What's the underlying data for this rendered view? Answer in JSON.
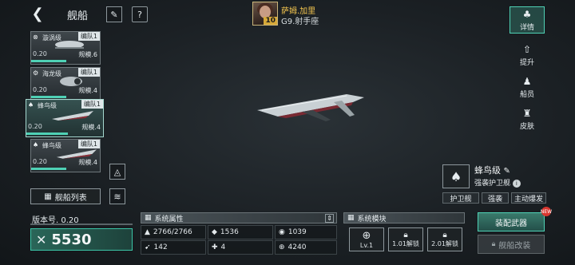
{
  "header": {
    "title": "舰船"
  },
  "captain": {
    "name": "萨姆.加里",
    "subtitle": "G9.射手座",
    "level": "10"
  },
  "ship_list": [
    {
      "name": "漩涡级",
      "fleet": "编队1",
      "level": "0.20",
      "scale": "规模.6",
      "selected": false
    },
    {
      "name": "海龙级",
      "fleet": "编队1",
      "level": "0.20",
      "scale": "规模.4",
      "selected": false
    },
    {
      "name": "蜂鸟级",
      "fleet": "编队1",
      "level": "0.20",
      "scale": "规模.4",
      "selected": true
    },
    {
      "name": "蜂鸟级",
      "fleet": "编队1",
      "level": "0.20",
      "scale": "规模.4",
      "selected": false
    }
  ],
  "fleet_list_label": "舰船列表",
  "version_label": "版本号. 0.20",
  "power": "5530",
  "attributes": {
    "title": "系统属性",
    "values": [
      "2766/2766",
      "1536",
      "1039",
      "142",
      "4",
      "4240"
    ]
  },
  "modules": {
    "title": "系统模块",
    "items": [
      {
        "label": "Lv.1",
        "icon": "target-icon"
      },
      {
        "label": "1.01解锁",
        "icon": "lock-icon"
      },
      {
        "label": "2.01解锁",
        "icon": "lock-icon"
      }
    ]
  },
  "side_nav": [
    "详情",
    "提升",
    "船员",
    "皮肤"
  ],
  "ship": {
    "name": "蜂鸟级",
    "type": "强袭护卫舰",
    "tags": [
      "护卫舰",
      "强袭",
      "主动爆发"
    ]
  },
  "equip_label": "装配武器",
  "new_badge": "NEW",
  "refit_label": "舰船改装",
  "colors": {
    "accent": "#4fd1b5",
    "captain_name": "#f0c34e",
    "badge": "#d9362f"
  }
}
